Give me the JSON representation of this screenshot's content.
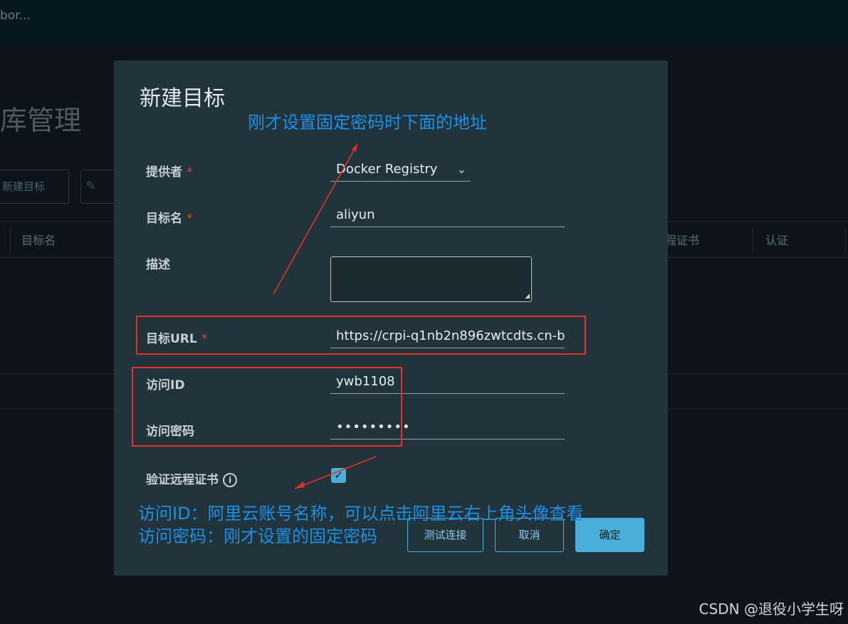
{
  "app": {
    "brand": "bor..."
  },
  "page": {
    "title": "库管理",
    "new_target_button": "新建目标",
    "columns": [
      "目标名",
      "远程证书",
      "认证"
    ]
  },
  "modal": {
    "title": "新建目标",
    "fields": {
      "provider": {
        "label": "提供者",
        "value": "Docker Registry"
      },
      "name": {
        "label": "目标名",
        "value": "aliyun"
      },
      "description": {
        "label": "描述",
        "value": ""
      },
      "url": {
        "label": "目标URL",
        "value": "https://crpi-q1nb2n896zwtcdts.cn-b"
      },
      "access_id": {
        "label": "访问ID",
        "value": "ywb1108"
      },
      "access_secret": {
        "label": "访问密码",
        "value": "•••••••••"
      },
      "verify_cert": {
        "label": "验证远程证书",
        "checked": true
      }
    },
    "required_mark": "*",
    "info_glyph": "i",
    "buttons": {
      "test": "测试连接",
      "cancel": "取消",
      "ok": "确定"
    }
  },
  "annotations": {
    "top_note": "刚才设置固定密码时下面的地址",
    "bottom_note_line1": "访问ID：阿里云账号名称，可以点击阿里云右上角头像查看",
    "bottom_note_line2": "访问密码：刚才设置的固定密码"
  },
  "watermark": "CSDN @退役小学生呀",
  "colors": {
    "accent": "#49afd9",
    "annotation_red": "#e8302a",
    "annotation_blue": "#1e8fe6",
    "modal_bg": "#21333b"
  }
}
